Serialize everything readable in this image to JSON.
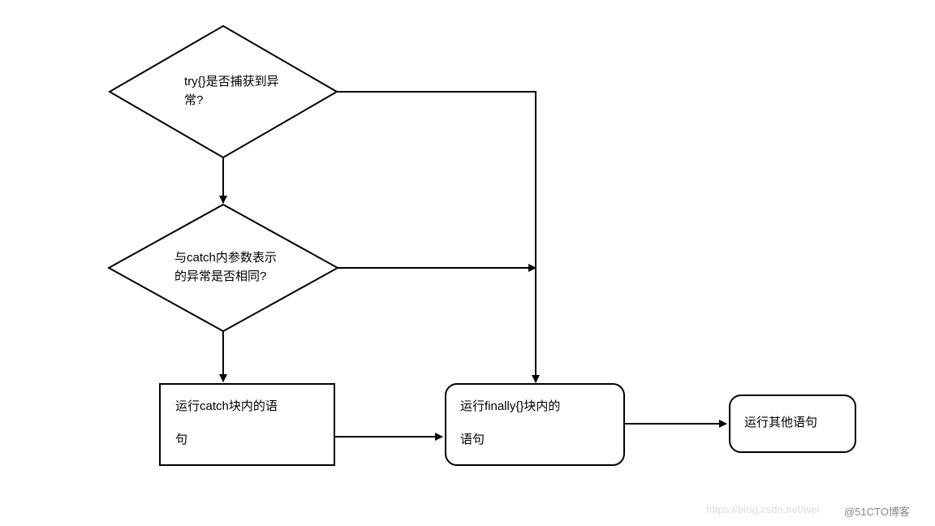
{
  "nodes": {
    "decision1": {
      "line1": "try{}是否捕获到异",
      "line2": "常?"
    },
    "decision2": {
      "line1": "与catch内参数表示",
      "line2": "的异常是否相同?"
    },
    "process_catch": {
      "line1": "运行catch块内的语",
      "line2": "句"
    },
    "process_finally": {
      "line1": "运行finally{}块内的",
      "line2": "语句"
    },
    "process_other": {
      "text": "运行其他语句"
    }
  },
  "watermark": {
    "left": "https://blog.csdn.net/wei",
    "right": "@51CTO博客"
  }
}
